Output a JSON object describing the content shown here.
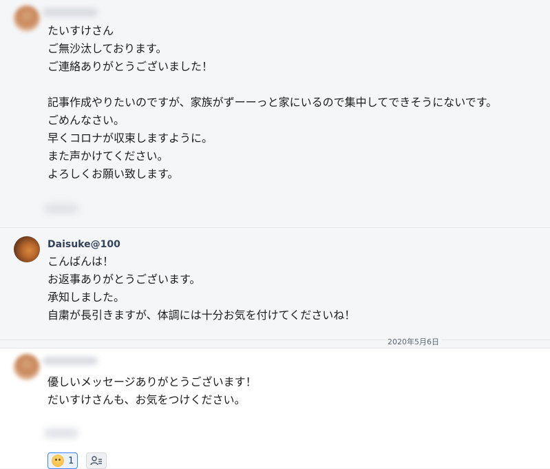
{
  "messages": [
    {
      "author": "",
      "lines": [
        "たいすけさん",
        "ご無沙汰しております。",
        "ご連絡ありがとうございました！",
        "",
        "記事作成やりたいのですが、家族がずーーっと家にいるので集中してできそうにないです。",
        "ごめんなさい。",
        "早くコロナが収束しますように。",
        "また声かけてください。",
        "よろしくお願い致します。"
      ]
    },
    {
      "author": "Daisuke@100",
      "lines": [
        "こんばんは！",
        "お返事ありがとうございます。",
        "承知しました。",
        "自粛が長引きますが、体調には十分お気を付けてくださいね！"
      ]
    },
    {
      "author": "",
      "lines": [
        "優しいメッセージありがとうございます！",
        "だいすけさんも、お気をつけください。"
      ]
    }
  ],
  "date_divider": "2020年5月6日",
  "reaction": {
    "emoji": "smile-emoji",
    "count": "1"
  },
  "icons": {
    "reactor_list": "people-list-icon"
  }
}
